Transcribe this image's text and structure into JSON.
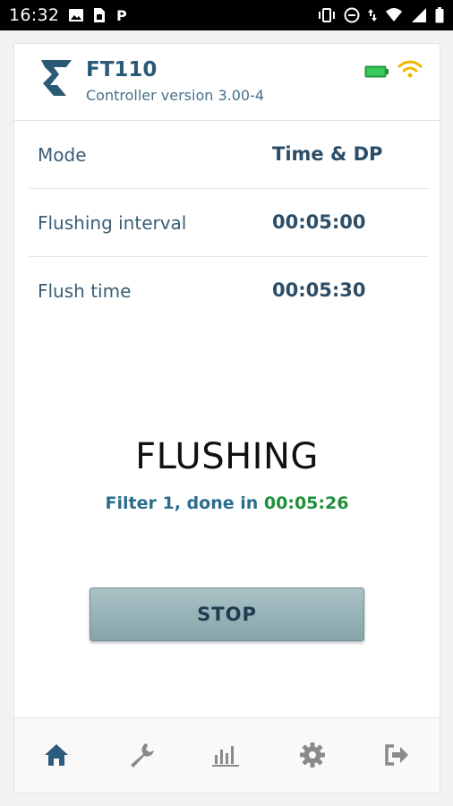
{
  "status_bar": {
    "time": "16:32",
    "left_icons": [
      "image-icon",
      "sim-icon",
      "p-icon"
    ],
    "right_icons": [
      "vibrate-icon",
      "dnd-icon",
      "data-arrows-icon",
      "signal-icon",
      "signal-icon",
      "battery-icon"
    ]
  },
  "header": {
    "device_name": "FT110",
    "controller_version": "Controller version 3.00-4",
    "battery_color": "#2bb24c",
    "wifi_color": "#f0b800"
  },
  "settings": [
    {
      "label": "Mode",
      "value": "Time & DP"
    },
    {
      "label": "Flushing interval",
      "value": "00:05:00"
    },
    {
      "label": "Flush time",
      "value": "00:05:30"
    }
  ],
  "status": {
    "state": "FLUSHING",
    "detail_prefix": "Filter 1, done in",
    "time_remaining": "00:05:26",
    "time_color": "#1f8f3a"
  },
  "stop_button": {
    "label": "STOP"
  },
  "nav": [
    {
      "icon": "home-icon",
      "active": true
    },
    {
      "icon": "wrench-icon",
      "active": false
    },
    {
      "icon": "chart-icon",
      "active": false
    },
    {
      "icon": "gear-icon",
      "active": false
    },
    {
      "icon": "logout-icon",
      "active": false
    }
  ],
  "colors": {
    "brand": "#2a5a74",
    "nav_active": "#2c5b80",
    "nav_inactive": "#8a8a8a"
  }
}
